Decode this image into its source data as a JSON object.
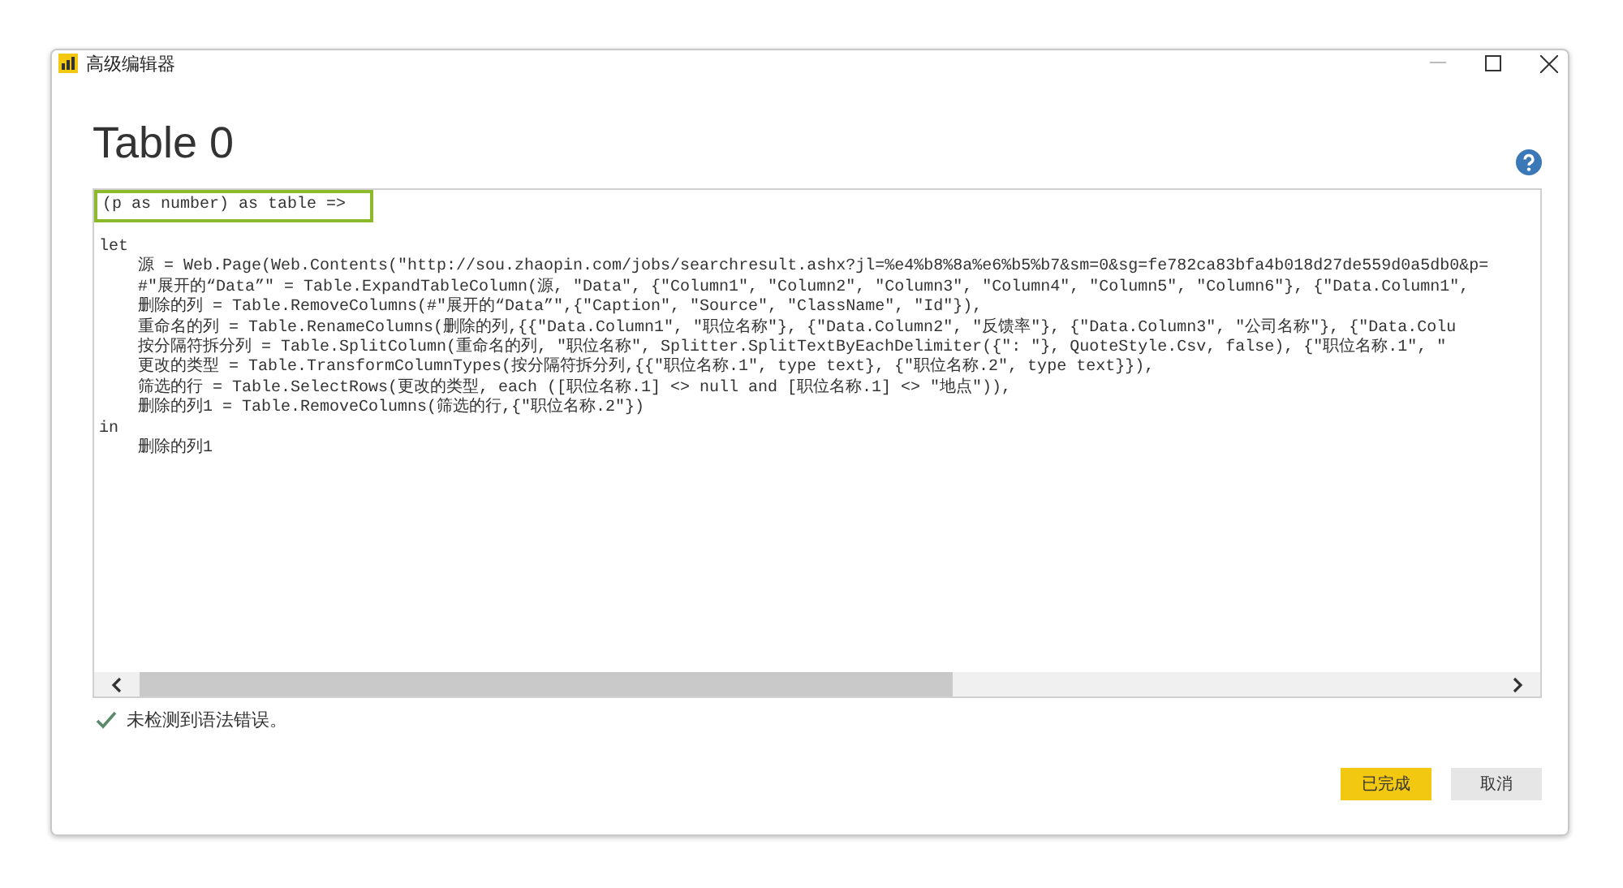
{
  "window": {
    "title": "高级编辑器"
  },
  "heading": "Table 0",
  "editor": {
    "signature": "(p as number) as table =>",
    "code_lines": [
      "let",
      "    源 = Web.Page(Web.Contents(\"http://sou.zhaopin.com/jobs/searchresult.ashx?jl=%e4%b8%8a%e6%b5%b7&sm=0&sg=fe782ca83bfa4b018d27de559d0a5db0&p=",
      "    #\"展开的“Data”\" = Table.ExpandTableColumn(源, \"Data\", {\"Column1\", \"Column2\", \"Column3\", \"Column4\", \"Column5\", \"Column6\"}, {\"Data.Column1\",",
      "    删除的列 = Table.RemoveColumns(#\"展开的“Data”\",{\"Caption\", \"Source\", \"ClassName\", \"Id\"}),",
      "    重命名的列 = Table.RenameColumns(删除的列,{{\"Data.Column1\", \"职位名称\"}, {\"Data.Column2\", \"反馈率\"}, {\"Data.Column3\", \"公司名称\"}, {\"Data.Colu",
      "    按分隔符拆分列 = Table.SplitColumn(重命名的列, \"职位名称\", Splitter.SplitTextByEachDelimiter({\": \"}, QuoteStyle.Csv, false), {\"职位名称.1\", \"",
      "    更改的类型 = Table.TransformColumnTypes(按分隔符拆分列,{{\"职位名称.1\", type text}, {\"职位名称.2\", type text}}),",
      "    筛选的行 = Table.SelectRows(更改的类型, each ([职位名称.1] <> null and [职位名称.1] <> \"地点\")),",
      "    删除的列1 = Table.RemoveColumns(筛选的行,{\"职位名称.2\"})",
      "in",
      "    删除的列1"
    ]
  },
  "status": "未检测到语法错误。",
  "buttons": [
    {
      "label": "已完成",
      "kind": "primary"
    },
    {
      "label": "取消",
      "kind": "secondary"
    }
  ]
}
